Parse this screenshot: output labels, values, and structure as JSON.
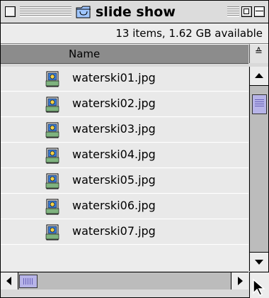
{
  "window": {
    "title": "slide show",
    "info": "13 items, 1.62 GB available"
  },
  "columns": {
    "name_header": "Name",
    "sort_glyph": "≙"
  },
  "files": [
    {
      "name": "waterski01.jpg",
      "icon": "jpeg-file-icon"
    },
    {
      "name": "waterski02.jpg",
      "icon": "jpeg-file-icon"
    },
    {
      "name": "waterski03.jpg",
      "icon": "jpeg-file-icon"
    },
    {
      "name": "waterski04.jpg",
      "icon": "jpeg-file-icon"
    },
    {
      "name": "waterski05.jpg",
      "icon": "jpeg-file-icon"
    },
    {
      "name": "waterski06.jpg",
      "icon": "jpeg-file-icon"
    },
    {
      "name": "waterski07.jpg",
      "icon": "jpeg-file-icon"
    }
  ],
  "colors": {
    "header_bg": "#8c8c8c",
    "list_bg": "#e9e9e9",
    "scroll_thumb": "#b7b4e8"
  }
}
